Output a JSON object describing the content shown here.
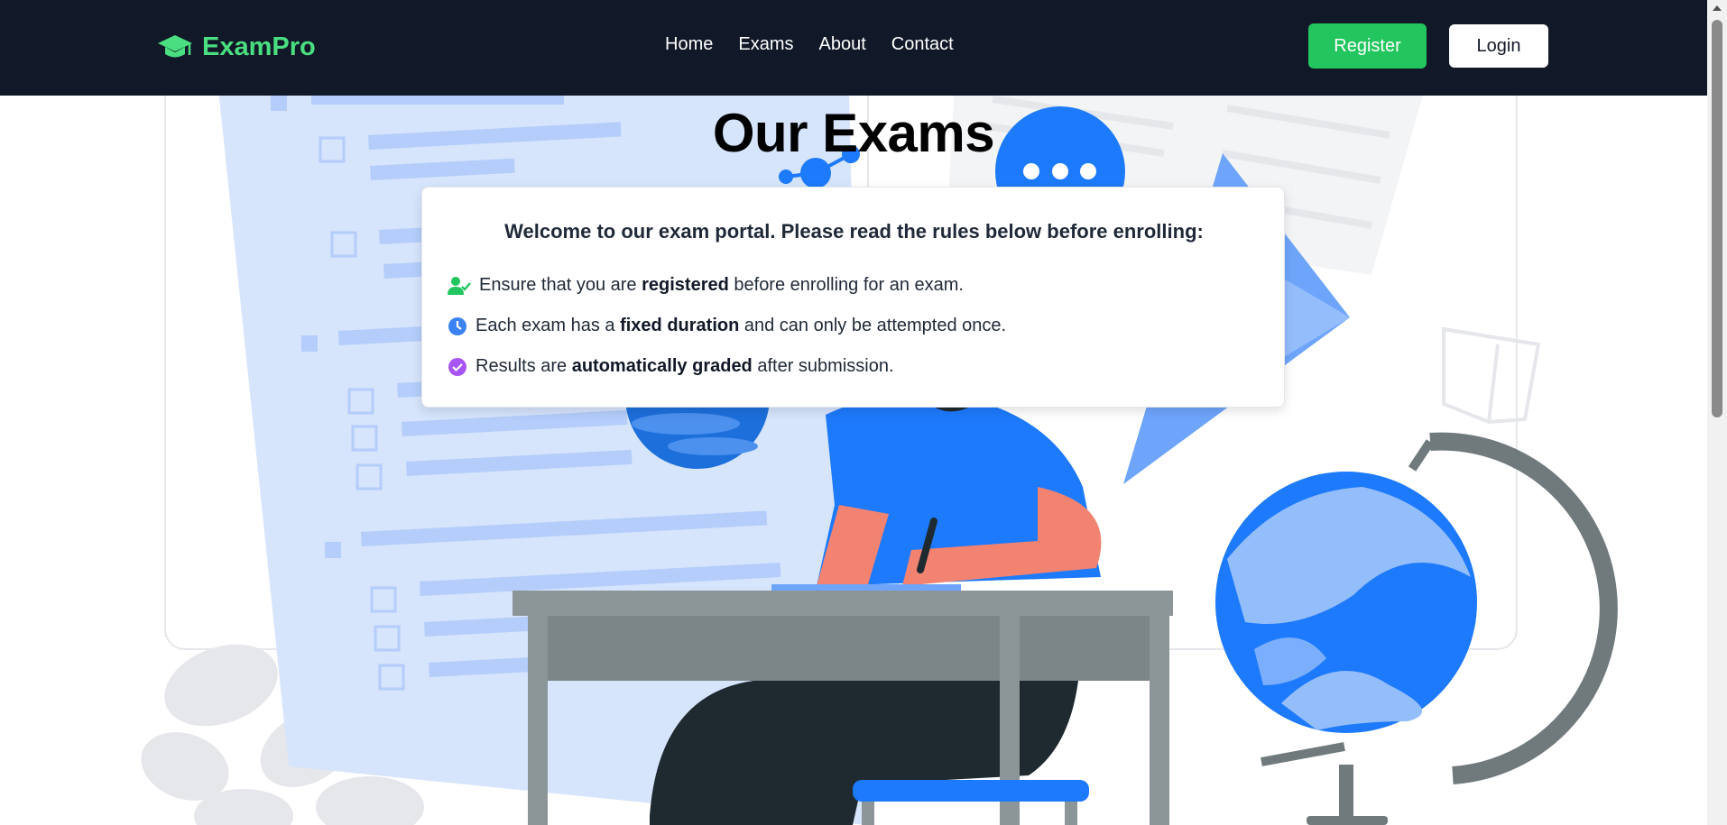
{
  "navbar": {
    "brand": "ExamPro",
    "links": [
      "Home",
      "Exams",
      "About",
      "Contact"
    ],
    "register_label": "Register",
    "login_label": "Login",
    "brand_color": "#4ade80",
    "bg_color": "#111827"
  },
  "main": {
    "title": "Our Exams",
    "rules": {
      "intro": "Welcome to our exam portal. Please read the rules below before enrolling:",
      "items": [
        {
          "icon": "user-check-icon",
          "icon_color": "#22c55e",
          "before": "Ensure that you are ",
          "bold": "registered",
          "after": " before enrolling for an exam."
        },
        {
          "icon": "clock-icon",
          "icon_color": "#3b82f6",
          "before": "Each exam has a ",
          "bold": "fixed duration",
          "after": " and can only be attempted once."
        },
        {
          "icon": "check-circle-icon",
          "icon_color": "#a855f7",
          "before": "Results are ",
          "bold": "automatically graded",
          "after": " after submission."
        }
      ]
    }
  }
}
